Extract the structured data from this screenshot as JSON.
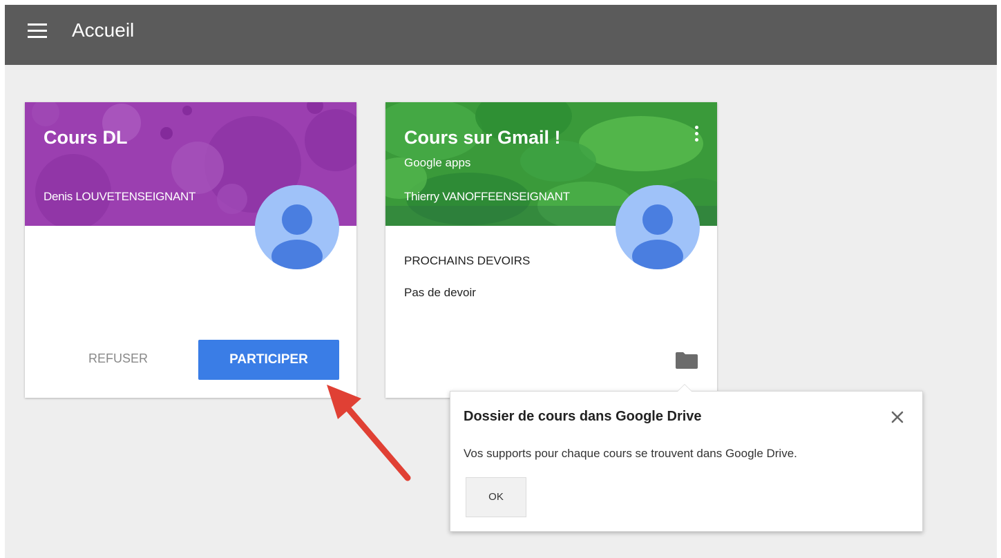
{
  "colors": {
    "topbar": "#5b5b5b",
    "background": "#eeeeee",
    "accent": "#3a7de6",
    "card_one_banner": "#9b3fb0",
    "card_two_banner": "#3a9a3a",
    "annotation_arrow": "#e04034"
  },
  "header": {
    "menu_icon": "hamburger-menu-icon",
    "title": "Accueil"
  },
  "cards": [
    {
      "title": "Cours DL",
      "subtitle": "",
      "teacher": "Denis LOUVETENSEIGNANT",
      "refuse_label": "REFUSER",
      "join_label": "PARTICIPER"
    },
    {
      "title": "Cours sur Gmail !",
      "subtitle": "Google apps",
      "teacher": "Thierry VANOFFEENSEIGNANT",
      "homework_title": "PROCHAINS DEVOIRS",
      "homework_empty": "Pas de devoir",
      "more_icon": "more-vert-icon",
      "folder_icon": "folder-icon"
    }
  ],
  "popup": {
    "title": "Dossier de cours dans Google Drive",
    "text": "Vos supports pour chaque cours se trouvent dans Google Drive.",
    "ok_label": "OK",
    "close_icon": "close-icon"
  }
}
